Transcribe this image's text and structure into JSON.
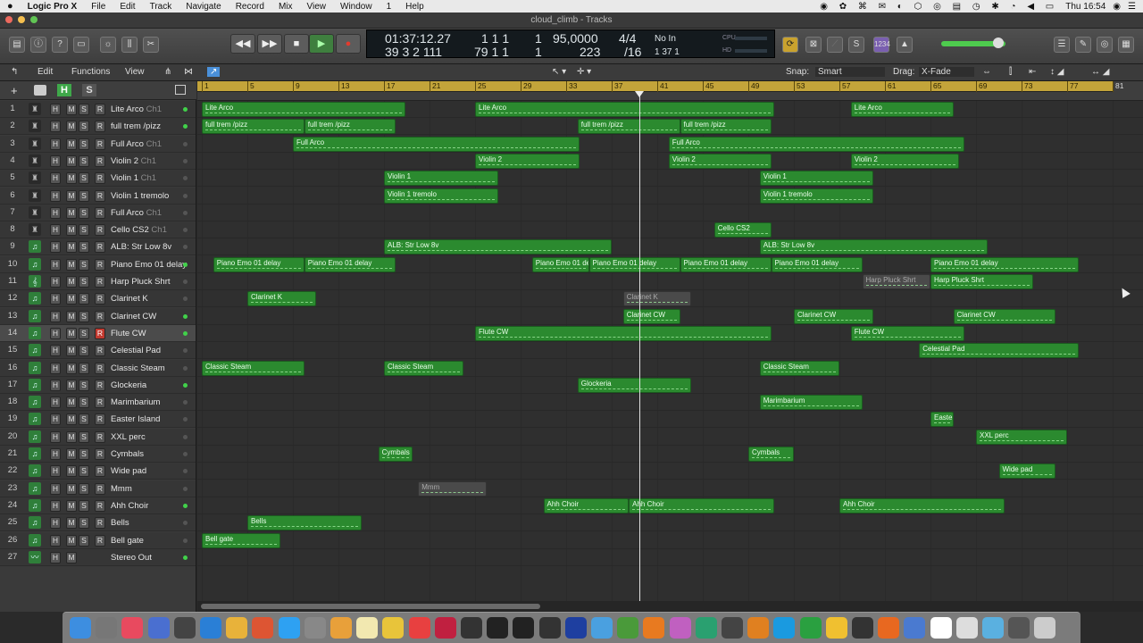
{
  "menubar": {
    "apple": "",
    "app": "Logic Pro X",
    "items": [
      "File",
      "Edit",
      "Track",
      "Navigate",
      "Record",
      "Mix",
      "View",
      "Window",
      "1",
      "Help"
    ],
    "clock": "Thu 16:54"
  },
  "window": {
    "title": "cloud_climb - Tracks"
  },
  "lcd": {
    "smpte": "01:37:12.27",
    "bars": "39 3 2 111",
    "beats_top": "1 1 1",
    "beats_bot": "79 1 1",
    "sub_top": "1",
    "sub_bot": "1",
    "tempo": "95,0000",
    "tempo_small": "223",
    "sig_top": "4/4",
    "sig_bot": "/16",
    "in": "No In",
    "out": "1  37  1",
    "cpu_label": "CPU",
    "hd_label": "HD"
  },
  "control": {
    "key_badge": "1234"
  },
  "trackheader": {
    "edit": "Edit",
    "functions": "Functions",
    "view": "View",
    "snap_label": "Snap:",
    "snap_value": "Smart",
    "drag_label": "Drag:",
    "drag_value": "X-Fade"
  },
  "ruler": {
    "bars": [
      "1",
      "5",
      "9",
      "13",
      "17",
      "21",
      "25",
      "29",
      "33",
      "37",
      "41",
      "45",
      "49",
      "53",
      "57",
      "61",
      "65",
      "69",
      "73",
      "77",
      "81"
    ]
  },
  "tracks": [
    {
      "num": "1",
      "name": "Lite Arco",
      "ch": "Ch1",
      "icon": "piano",
      "rec": false,
      "dot": true
    },
    {
      "num": "2",
      "name": "full trem /pizz",
      "ch": "",
      "icon": "piano",
      "rec": false,
      "dot": true
    },
    {
      "num": "3",
      "name": "Full Arco",
      "ch": "Ch1",
      "icon": "piano",
      "rec": false,
      "dot": false
    },
    {
      "num": "4",
      "name": "Violin 2",
      "ch": "Ch1",
      "icon": "piano",
      "rec": false,
      "dot": false
    },
    {
      "num": "5",
      "name": "Violin 1",
      "ch": "Ch1",
      "icon": "piano",
      "rec": false,
      "dot": false
    },
    {
      "num": "6",
      "name": "Violin 1 tremolo",
      "ch": "",
      "icon": "piano",
      "rec": false,
      "dot": false
    },
    {
      "num": "7",
      "name": "Full Arco",
      "ch": "Ch1",
      "icon": "piano",
      "rec": false,
      "dot": false
    },
    {
      "num": "8",
      "name": "Cello CS2",
      "ch": "Ch1",
      "icon": "piano",
      "rec": false,
      "dot": false
    },
    {
      "num": "9",
      "name": "ALB: Str Low 8v",
      "ch": "",
      "icon": "note",
      "rec": false,
      "dot": false
    },
    {
      "num": "10",
      "name": "Piano Emo 01 delay",
      "ch": "",
      "icon": "note",
      "rec": false,
      "dot": true
    },
    {
      "num": "11",
      "name": "Harp Pluck Shrt",
      "ch": "",
      "icon": "harp",
      "rec": false,
      "dot": false
    },
    {
      "num": "12",
      "name": "Clarinet K",
      "ch": "",
      "icon": "note",
      "rec": false,
      "dot": false
    },
    {
      "num": "13",
      "name": "Clarinet CW",
      "ch": "",
      "icon": "note",
      "rec": false,
      "dot": true
    },
    {
      "num": "14",
      "name": "Flute CW",
      "ch": "",
      "icon": "note",
      "rec": true,
      "dot": true
    },
    {
      "num": "15",
      "name": "Celestial Pad",
      "ch": "",
      "icon": "note",
      "rec": false,
      "dot": false
    },
    {
      "num": "16",
      "name": "Classic Steam",
      "ch": "",
      "icon": "note",
      "rec": false,
      "dot": false
    },
    {
      "num": "17",
      "name": "Glockeria",
      "ch": "",
      "icon": "note",
      "rec": false,
      "dot": true
    },
    {
      "num": "18",
      "name": "Marimbarium",
      "ch": "",
      "icon": "note",
      "rec": false,
      "dot": false
    },
    {
      "num": "19",
      "name": "Easter Island",
      "ch": "",
      "icon": "note",
      "rec": false,
      "dot": false
    },
    {
      "num": "20",
      "name": "XXL perc",
      "ch": "",
      "icon": "note",
      "rec": false,
      "dot": false
    },
    {
      "num": "21",
      "name": "Cymbals",
      "ch": "",
      "icon": "note",
      "rec": false,
      "dot": false
    },
    {
      "num": "22",
      "name": "Wide pad",
      "ch": "",
      "icon": "note",
      "rec": false,
      "dot": false
    },
    {
      "num": "23",
      "name": "Mmm",
      "ch": "",
      "icon": "note",
      "rec": false,
      "dot": false
    },
    {
      "num": "24",
      "name": "Ahh Choir",
      "ch": "",
      "icon": "note",
      "rec": false,
      "dot": true
    },
    {
      "num": "25",
      "name": "Bells",
      "ch": "",
      "icon": "note",
      "rec": false,
      "dot": false
    },
    {
      "num": "26",
      "name": "Bell gate",
      "ch": "",
      "icon": "note",
      "rec": false,
      "dot": false
    },
    {
      "num": "27",
      "name": "Stereo Out",
      "ch": "",
      "icon": "out",
      "rec": false,
      "dot": true
    }
  ],
  "regions": [
    {
      "t": 0,
      "s": 1,
      "e": 18.9,
      "label": "Lite Arco"
    },
    {
      "t": 0,
      "s": 25,
      "e": 51.3,
      "label": "Lite Arco"
    },
    {
      "t": 0,
      "s": 58,
      "e": 67,
      "label": "Lite Arco"
    },
    {
      "t": 1,
      "s": 1,
      "e": 10,
      "label": "full trem /pizz"
    },
    {
      "t": 1,
      "s": 10,
      "e": 18,
      "label": "full trem /pizz"
    },
    {
      "t": 1,
      "s": 34,
      "e": 43,
      "label": "full trem /pizz"
    },
    {
      "t": 1,
      "s": 43,
      "e": 51,
      "label": "full trem /pizz"
    },
    {
      "t": 2,
      "s": 9,
      "e": 34.2,
      "label": "Full Arco"
    },
    {
      "t": 2,
      "s": 42,
      "e": 68,
      "label": "Full Arco"
    },
    {
      "t": 3,
      "s": 25,
      "e": 34.2,
      "label": "Violin 2"
    },
    {
      "t": 3,
      "s": 42,
      "e": 51,
      "label": "Violin 2"
    },
    {
      "t": 3,
      "s": 58,
      "e": 67.5,
      "label": "Violin 2"
    },
    {
      "t": 4,
      "s": 17,
      "e": 27,
      "label": "Violin 1"
    },
    {
      "t": 4,
      "s": 50,
      "e": 60,
      "label": "Violin 1"
    },
    {
      "t": 5,
      "s": 17,
      "e": 27,
      "label": "Violin 1 tremolo"
    },
    {
      "t": 5,
      "s": 50,
      "e": 60,
      "label": "Violin 1 tremolo"
    },
    {
      "t": 7,
      "s": 46,
      "e": 51,
      "label": "Cello CS2"
    },
    {
      "t": 8,
      "s": 17,
      "e": 37,
      "label": "ALB: Str Low 8v"
    },
    {
      "t": 8,
      "s": 50,
      "e": 70,
      "label": "ALB: Str Low 8v"
    },
    {
      "t": 9,
      "s": 2,
      "e": 10,
      "label": "Piano Emo 01 delay"
    },
    {
      "t": 9,
      "s": 10,
      "e": 18,
      "label": "Piano Emo 01 delay"
    },
    {
      "t": 9,
      "s": 30,
      "e": 35,
      "label": "Piano Emo 01 de"
    },
    {
      "t": 9,
      "s": 35,
      "e": 43,
      "label": "Piano Emo 01 delay"
    },
    {
      "t": 9,
      "s": 43,
      "e": 51,
      "label": "Piano Emo 01 delay"
    },
    {
      "t": 9,
      "s": 51,
      "e": 59,
      "label": "Piano Emo 01 delay"
    },
    {
      "t": 9,
      "s": 65,
      "e": 78,
      "label": "Piano Emo 01 delay"
    },
    {
      "t": 10,
      "s": 59,
      "e": 65,
      "label": "Harp Pluck Shrt",
      "dim": true
    },
    {
      "t": 10,
      "s": 65,
      "e": 74,
      "label": "Harp Pluck Shrt"
    },
    {
      "t": 11,
      "s": 5,
      "e": 11,
      "label": "Clarinet K"
    },
    {
      "t": 11,
      "s": 38,
      "e": 44,
      "label": "Clarinet K",
      "dim": true
    },
    {
      "t": 12,
      "s": 38,
      "e": 43,
      "label": "Clarinet CW"
    },
    {
      "t": 12,
      "s": 53,
      "e": 60,
      "label": "Clarinet CW"
    },
    {
      "t": 12,
      "s": 67,
      "e": 76,
      "label": "Clarinet CW"
    },
    {
      "t": 13,
      "s": 25,
      "e": 51,
      "label": "Flute CW"
    },
    {
      "t": 13,
      "s": 58,
      "e": 68,
      "label": "Flute CW"
    },
    {
      "t": 14,
      "s": 64,
      "e": 78,
      "label": "Celestial Pad"
    },
    {
      "t": 15,
      "s": 1,
      "e": 10,
      "label": "Classic Steam"
    },
    {
      "t": 15,
      "s": 17,
      "e": 24,
      "label": "Classic Steam"
    },
    {
      "t": 15,
      "s": 50,
      "e": 57,
      "label": "Classic Steam"
    },
    {
      "t": 16,
      "s": 34,
      "e": 44,
      "label": "Glockeria"
    },
    {
      "t": 17,
      "s": 50,
      "e": 59,
      "label": "Marimbarium"
    },
    {
      "t": 18,
      "s": 65,
      "e": 67,
      "label": "Easter Island"
    },
    {
      "t": 19,
      "s": 69,
      "e": 77,
      "label": "XXL perc"
    },
    {
      "t": 20,
      "s": 16.5,
      "e": 19.5,
      "label": "Cymbals"
    },
    {
      "t": 20,
      "s": 49,
      "e": 53,
      "label": "Cymbals"
    },
    {
      "t": 21,
      "s": 71,
      "e": 76,
      "label": "Wide pad"
    },
    {
      "t": 22,
      "s": 20,
      "e": 26,
      "label": "Mmm",
      "dim": true
    },
    {
      "t": 23,
      "s": 31,
      "e": 38.5,
      "label": "Ahh Choir"
    },
    {
      "t": 23,
      "s": 38.5,
      "e": 51.3,
      "label": "Ahh Choir"
    },
    {
      "t": 23,
      "s": 57,
      "e": 71.5,
      "label": "Ahh Choir"
    },
    {
      "t": 24,
      "s": 5,
      "e": 15,
      "label": "Bells"
    },
    {
      "t": 25,
      "s": 1,
      "e": 7.9,
      "label": "Bell gate"
    }
  ],
  "colors": {
    "region": "#2b8a2f",
    "ruler": "#c3a43a",
    "record": "#c23a30",
    "led": "#41d14a"
  }
}
